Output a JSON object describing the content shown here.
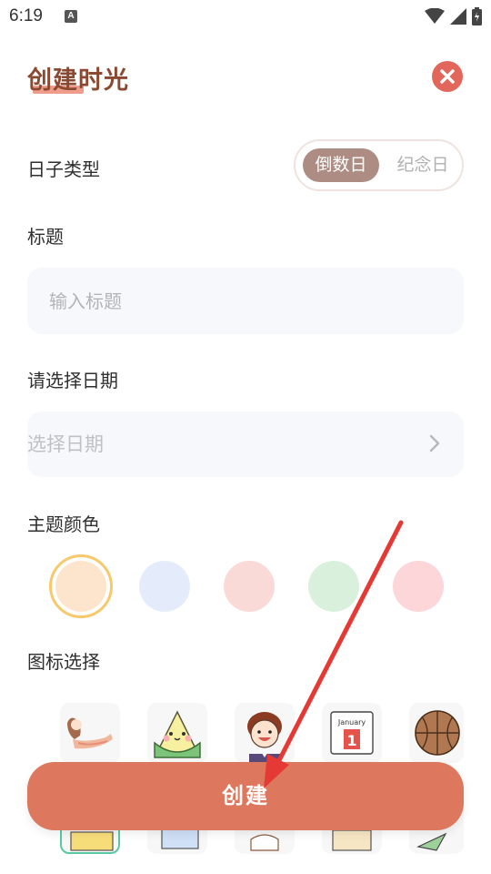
{
  "status_bar": {
    "time": "6:19",
    "notification_letter": "A"
  },
  "header": {
    "title": "创建时光"
  },
  "day_type": {
    "label": "日子类型",
    "options": [
      "倒数日",
      "纪念日"
    ],
    "selected": "倒数日"
  },
  "title_field": {
    "label": "标题",
    "placeholder": "输入标题",
    "value": ""
  },
  "date_field": {
    "label": "请选择日期",
    "placeholder": "选择日期"
  },
  "theme_color": {
    "label": "主题颜色",
    "options": [
      "#fde5cd",
      "#e4ecfb",
      "#fadad7",
      "#d9f0dc",
      "#fdd6d9"
    ],
    "selected": "#fde5cd"
  },
  "icon_select": {
    "label": "图标选择",
    "icons": [
      "yoga-girl-icon",
      "zongzi-icon",
      "cartoon-boy-icon",
      "calendar-january-icon",
      "basketball-icon"
    ],
    "calendar_text": {
      "month": "January",
      "day": "1"
    }
  },
  "actions": {
    "create_label": "创建"
  },
  "colors": {
    "brand": "#dd775e",
    "title": "#8a4a32",
    "close": "#e2665a",
    "arrow": "#e53935"
  }
}
